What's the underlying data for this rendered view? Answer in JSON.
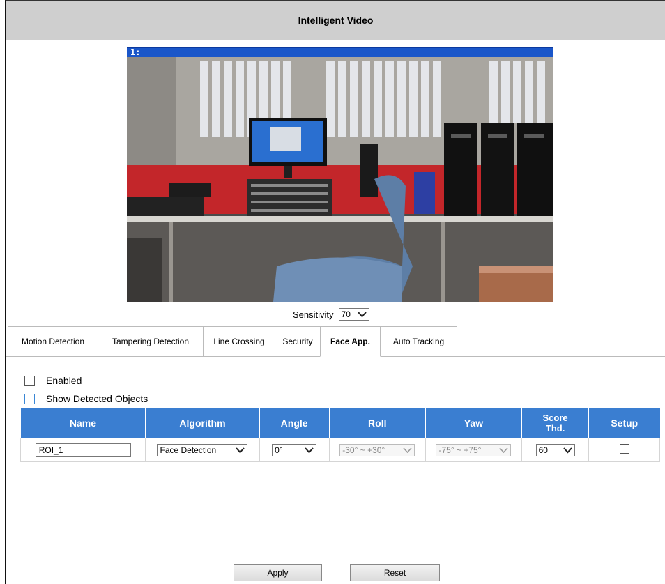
{
  "header": {
    "title": "Intelligent Video"
  },
  "video": {
    "channel_label": "1:"
  },
  "sensitivity": {
    "label": "Sensitivity",
    "value": "70"
  },
  "tabs": [
    {
      "label": "Motion Detection"
    },
    {
      "label": "Tampering Detection"
    },
    {
      "label": "Line Crossing"
    },
    {
      "label": "Security"
    },
    {
      "label": "Face App.",
      "active": true
    },
    {
      "label": "Auto Tracking"
    }
  ],
  "options": {
    "enabled_label": "Enabled",
    "show_objects_label": "Show Detected Objects"
  },
  "table": {
    "headers": {
      "name": "Name",
      "algorithm": "Algorithm",
      "angle": "Angle",
      "roll": "Roll",
      "yaw": "Yaw",
      "score_line1": "Score",
      "score_line2": "Thd.",
      "setup": "Setup"
    },
    "row": {
      "name": "ROI_1",
      "algorithm": "Face Detection",
      "angle": "0°",
      "roll": "-30° ~ +30°",
      "yaw": "-75° ~ +75°",
      "score": "60"
    }
  },
  "buttons": {
    "apply": "Apply",
    "reset": "Reset"
  },
  "colors": {
    "header_bg": "#cfcfcf",
    "table_header": "#3a7ed1",
    "video_bar": "#1a56c9"
  },
  "icons": [
    "chevron-down-icon",
    "checkbox-icon"
  ]
}
